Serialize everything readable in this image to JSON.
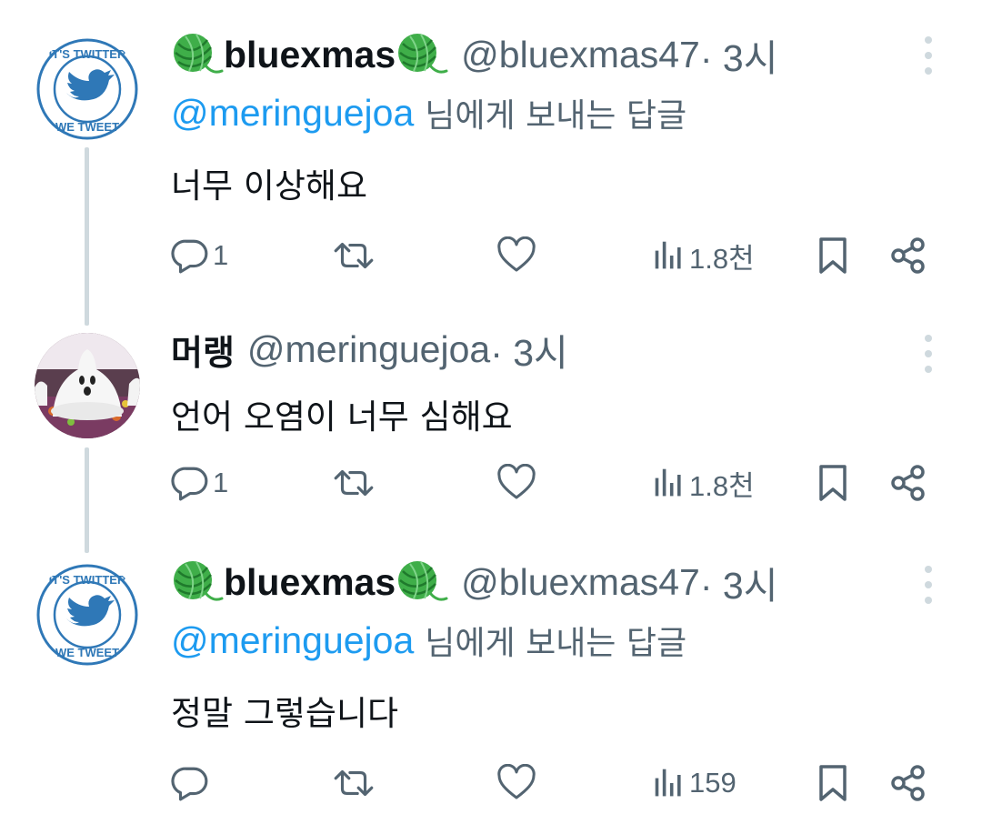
{
  "colors": {
    "accent": "#1d9bf0",
    "secondary_text": "#536471",
    "primary_text": "#0f1419",
    "thread_line": "#cfd9de",
    "yarn_green": "#3fae49"
  },
  "tweets": [
    {
      "display_name": "bluexmas",
      "name_emoji": "yarn-ball-emoji",
      "handle": "@bluexmas47",
      "time": " · 3시",
      "avatar": "its-twitter-we-tweet-badge",
      "reply_mention": "@meringuejoa",
      "reply_suffix": "님에게 보내는 답글",
      "text": "너무 이상해요",
      "replies": "1",
      "retweets": "",
      "likes": "",
      "views": "1.8천"
    },
    {
      "display_name": "머랭",
      "handle": "@meringuejoa",
      "time": " · 3시",
      "avatar": "ghost-meringue-photo",
      "text": "언어 오염이 너무 심해요",
      "replies": "1",
      "retweets": "",
      "likes": "",
      "views": "1.8천"
    },
    {
      "display_name": "bluexmas",
      "name_emoji": "yarn-ball-emoji",
      "handle": "@bluexmas47",
      "time": " · 3시",
      "avatar": "its-twitter-we-tweet-badge",
      "reply_mention": "@meringuejoa",
      "reply_suffix": "님에게 보내는 답글",
      "text": "정말 그렇습니다",
      "replies": "",
      "retweets": "",
      "likes": "",
      "views": "159"
    }
  ]
}
